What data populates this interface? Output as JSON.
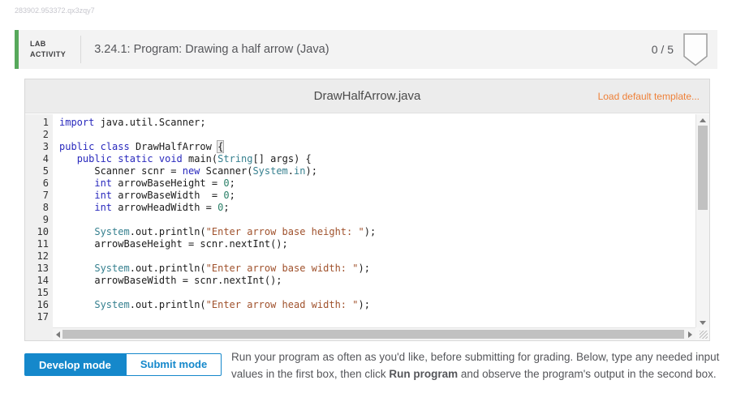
{
  "page": {
    "doc_id": "283902.953372.qx3zqy7"
  },
  "activity_header": {
    "kicker_line1": "LAB",
    "kicker_line2": "ACTIVITY",
    "title": "3.24.1: Program: Drawing a half arrow (Java)",
    "score": "0 / 5",
    "accent_color": "#57a85b"
  },
  "editor": {
    "filename": "DrawHalfArrow.java",
    "load_template_label": "Load default template...",
    "link_color": "#ee8038",
    "token_colors": {
      "keyword": "#2929bd",
      "type": "#36808f",
      "string": "#a0522d",
      "number": "#2b8068"
    },
    "code_lines": [
      {
        "n": 1,
        "tokens": [
          [
            "kw",
            "import"
          ],
          [
            "pl",
            " java.util.Scanner;"
          ]
        ]
      },
      {
        "n": 2,
        "tokens": []
      },
      {
        "n": 3,
        "tokens": [
          [
            "kw",
            "public"
          ],
          [
            "pl",
            " "
          ],
          [
            "kw",
            "class"
          ],
          [
            "pl",
            " DrawHalfArrow "
          ],
          [
            "hl",
            "{"
          ]
        ]
      },
      {
        "n": 4,
        "tokens": [
          [
            "pl",
            "   "
          ],
          [
            "kw",
            "public"
          ],
          [
            "pl",
            " "
          ],
          [
            "kw",
            "static"
          ],
          [
            "pl",
            " "
          ],
          [
            "kw",
            "void"
          ],
          [
            "pl",
            " main("
          ],
          [
            "cls",
            "String"
          ],
          [
            "pl",
            "[] args) {"
          ]
        ]
      },
      {
        "n": 5,
        "tokens": [
          [
            "pl",
            "      Scanner scnr = "
          ],
          [
            "kw",
            "new"
          ],
          [
            "pl",
            " Scanner("
          ],
          [
            "cls",
            "System"
          ],
          [
            "pl",
            "."
          ],
          [
            "cls",
            "in"
          ],
          [
            "pl",
            ");"
          ]
        ]
      },
      {
        "n": 6,
        "tokens": [
          [
            "pl",
            "      "
          ],
          [
            "kw",
            "int"
          ],
          [
            "pl",
            " arrowBaseHeight = "
          ],
          [
            "num",
            "0"
          ],
          [
            "pl",
            ";"
          ]
        ]
      },
      {
        "n": 7,
        "tokens": [
          [
            "pl",
            "      "
          ],
          [
            "kw",
            "int"
          ],
          [
            "pl",
            " arrowBaseWidth  = "
          ],
          [
            "num",
            "0"
          ],
          [
            "pl",
            ";"
          ]
        ]
      },
      {
        "n": 8,
        "tokens": [
          [
            "pl",
            "      "
          ],
          [
            "kw",
            "int"
          ],
          [
            "pl",
            " arrowHeadWidth = "
          ],
          [
            "num",
            "0"
          ],
          [
            "pl",
            ";"
          ]
        ]
      },
      {
        "n": 9,
        "tokens": []
      },
      {
        "n": 10,
        "tokens": [
          [
            "pl",
            "      "
          ],
          [
            "cls",
            "System"
          ],
          [
            "pl",
            ".out.println("
          ],
          [
            "str",
            "\"Enter arrow base height: \""
          ],
          [
            "pl",
            ");"
          ]
        ]
      },
      {
        "n": 11,
        "tokens": [
          [
            "pl",
            "      arrowBaseHeight = scnr.nextInt();"
          ]
        ]
      },
      {
        "n": 12,
        "tokens": []
      },
      {
        "n": 13,
        "tokens": [
          [
            "pl",
            "      "
          ],
          [
            "cls",
            "System"
          ],
          [
            "pl",
            ".out.println("
          ],
          [
            "str",
            "\"Enter arrow base width: \""
          ],
          [
            "pl",
            ");"
          ]
        ]
      },
      {
        "n": 14,
        "tokens": [
          [
            "pl",
            "      arrowBaseWidth = scnr.nextInt();"
          ]
        ]
      },
      {
        "n": 15,
        "tokens": []
      },
      {
        "n": 16,
        "tokens": [
          [
            "pl",
            "      "
          ],
          [
            "cls",
            "System"
          ],
          [
            "pl",
            ".out.println("
          ],
          [
            "str",
            "\"Enter arrow head width: \""
          ],
          [
            "pl",
            ");"
          ]
        ]
      },
      {
        "n": 17,
        "tokens": []
      }
    ]
  },
  "mode_buttons": {
    "develop_label": "Develop mode",
    "submit_label": "Submit mode",
    "active_color": "#1588cb"
  },
  "instructions": {
    "before": "Run your program as often as you'd like, before submitting for grading. Below, type any needed input values in the first box, then click ",
    "bold": "Run program",
    "after": " and observe the program's output in the second box."
  }
}
